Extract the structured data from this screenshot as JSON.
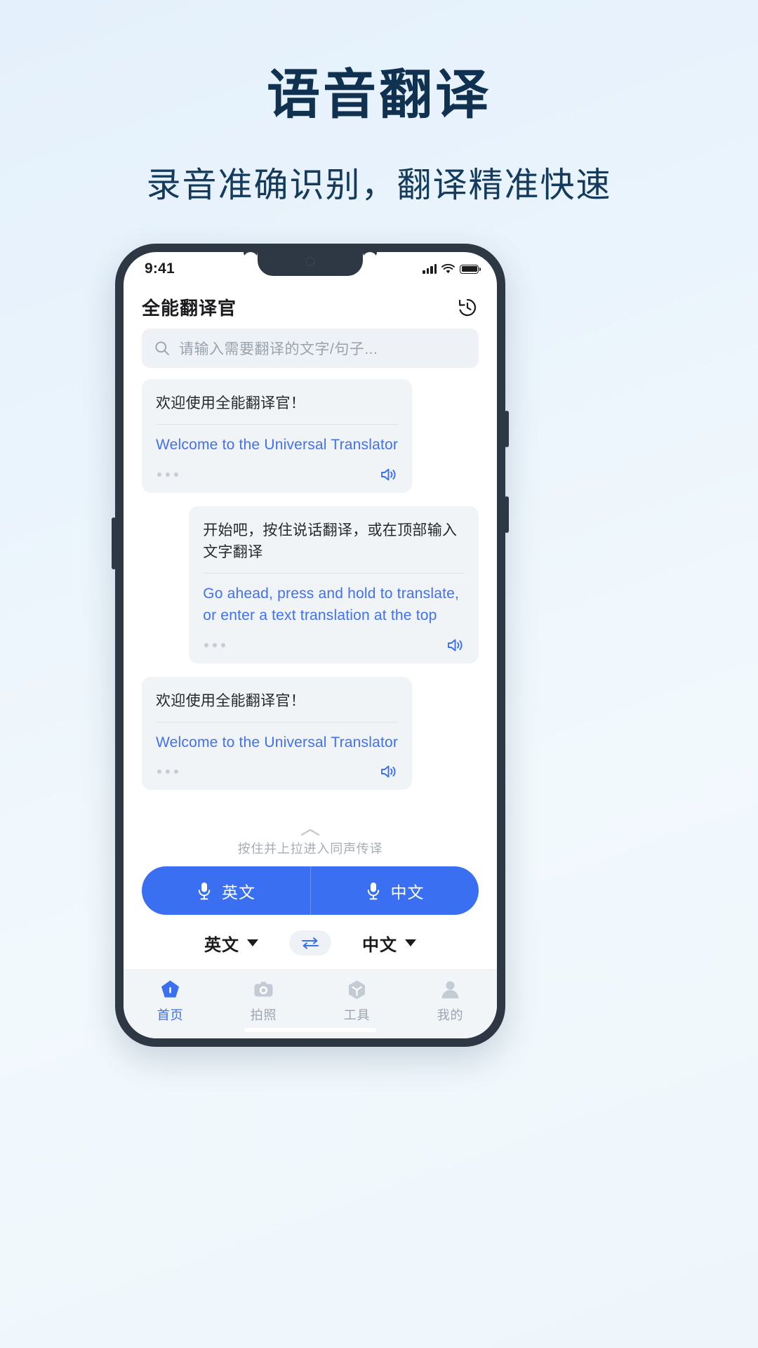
{
  "promo": {
    "title": "语音翻译",
    "subtitle": "录音准确识别，翻译精准快速",
    "title_color": "#10314f",
    "accent_color": "#3a6ff2"
  },
  "status_bar": {
    "time": "9:41",
    "signal_icon": "signal-bars-icon",
    "wifi_icon": "wifi-icon",
    "battery_icon": "battery-full-icon"
  },
  "app_header": {
    "title": "全能翻译官",
    "history_icon": "history-icon"
  },
  "search": {
    "icon": "search-icon",
    "placeholder": "请输入需要翻译的文字/句子...",
    "value": ""
  },
  "messages": [
    {
      "align": "left",
      "source": "欢迎使用全能翻译官！",
      "target": "Welcome to the Universal Translator",
      "more_icon": "more-dots-icon",
      "speaker_icon": "speaker-icon"
    },
    {
      "align": "right",
      "source": "开始吧，按住说话翻译，或在顶部输入文字翻译",
      "target": "Go ahead, press and hold to translate, or enter a text translation at the top",
      "more_icon": "more-dots-icon",
      "speaker_icon": "speaker-icon"
    },
    {
      "align": "left",
      "source": "欢迎使用全能翻译官！",
      "target": "Welcome to the Universal Translator",
      "more_icon": "more-dots-icon",
      "speaker_icon": "speaker-icon"
    }
  ],
  "pull_hint": {
    "chevron_icon": "chevron-up-icon",
    "text": "按住并上拉进入同声传译"
  },
  "record_buttons": [
    {
      "label": "英文",
      "icon": "microphone-icon"
    },
    {
      "label": "中文",
      "icon": "microphone-icon"
    }
  ],
  "language_row": {
    "source_lang": "英文",
    "target_lang": "中文",
    "swap_icon": "swap-arrows-icon",
    "caret_icon": "caret-down-icon"
  },
  "tabs": [
    {
      "label": "首页",
      "icon": "home-icon",
      "active": true
    },
    {
      "label": "拍照",
      "icon": "camera-icon",
      "active": false
    },
    {
      "label": "工具",
      "icon": "tools-cube-icon",
      "active": false
    },
    {
      "label": "我的",
      "icon": "user-profile-icon",
      "active": false
    }
  ]
}
